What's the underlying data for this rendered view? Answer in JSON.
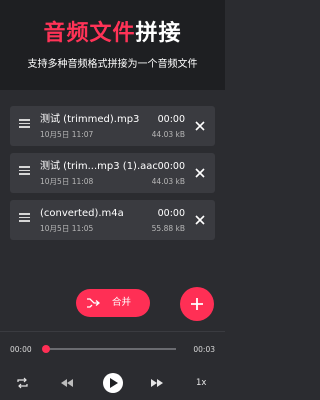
{
  "header": {
    "title_accent": "音频文件",
    "title_plain": "拼接",
    "subtitle": "支持多种音频格式拼接为一个音频文件"
  },
  "files": [
    {
      "name": "测试 (trimmed).mp3",
      "date": "10月5日 11:07",
      "duration": "00:00",
      "size": "44.03 kB"
    },
    {
      "name": "测试 (trim...mp3 (1).aac",
      "date": "10月5日 11:08",
      "duration": "00:00",
      "size": "44.03 kB"
    },
    {
      "name": "(converted).m4a",
      "date": "10月5日 11:05",
      "duration": "00:00",
      "size": "55.88 kB"
    }
  ],
  "actions": {
    "merge_label": "合并"
  },
  "player": {
    "current_time": "00:00",
    "total_time": "00:03",
    "progress": 0,
    "speed": "1x"
  },
  "colors": {
    "accent": "#ff2f55",
    "background": "#2b2c30",
    "card": "#3a3b40",
    "header": "#1e1f22"
  },
  "icons": {
    "drag": "drag-handle-icon",
    "remove": "close-icon",
    "merge": "merge-arrows-icon",
    "add": "plus-icon",
    "repeat": "repeat-icon",
    "rewind": "rewind-icon",
    "play": "play-icon",
    "forward": "fast-forward-icon"
  }
}
